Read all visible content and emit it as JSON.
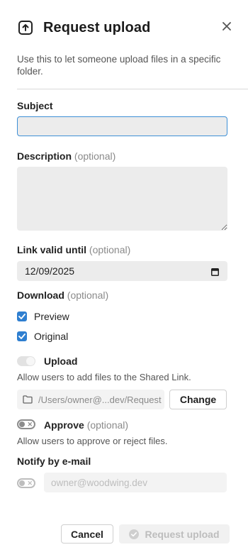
{
  "dialog": {
    "title": "Request upload",
    "icon": "upload-icon",
    "close_icon": "close-icon",
    "intro": "Use this to let someone upload files in a specific folder."
  },
  "subject": {
    "label": "Subject",
    "value": ""
  },
  "description": {
    "label": "Description",
    "optional": "(optional)",
    "value": ""
  },
  "link_valid_until": {
    "label": "Link valid until",
    "optional": "(optional)",
    "value": "12/09/2025",
    "icon": "calendar-icon"
  },
  "download": {
    "label": "Download",
    "optional": "(optional)",
    "options": [
      {
        "label": "Preview",
        "checked": true
      },
      {
        "label": "Original",
        "checked": true
      }
    ]
  },
  "upload": {
    "label": "Upload",
    "enabled": true,
    "disabled": true,
    "help": "Allow users to add files to the Shared Link.",
    "path": "/Users/owner@...dev/Request",
    "folder_icon": "folder-icon",
    "change_label": "Change"
  },
  "approve": {
    "label": "Approve",
    "optional": "(optional)",
    "enabled": false,
    "help": "Allow users to approve or reject files."
  },
  "notify": {
    "label": "Notify by e-mail",
    "enabled": false,
    "placeholder": "owner@woodwing.dev"
  },
  "footer": {
    "cancel_label": "Cancel",
    "submit_label": "Request upload",
    "submit_icon": "check-circle-icon"
  },
  "colors": {
    "accent": "#2f7fd0",
    "focus_border": "#3d8fd6",
    "field_bg": "#ececec",
    "muted_text": "#8a8a8a"
  }
}
